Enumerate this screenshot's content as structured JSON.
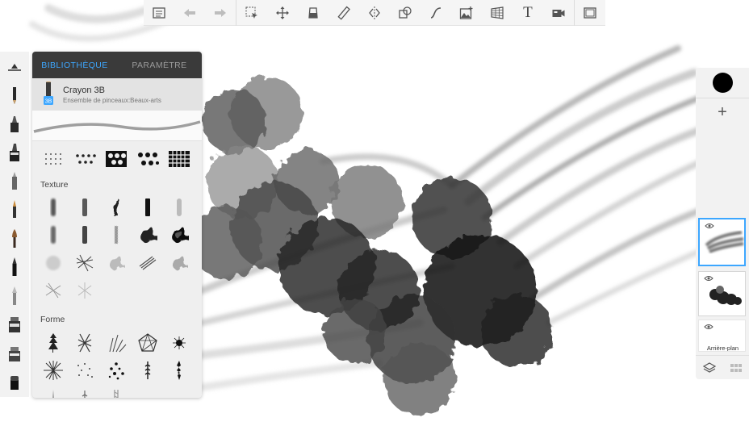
{
  "top_toolbar": {
    "tools": [
      "list-icon",
      "undo-icon",
      "redo-icon",
      "select-icon",
      "move-icon",
      "fill-icon",
      "ruler-icon",
      "symmetry-icon",
      "shapes-icon",
      "curve-icon",
      "image-icon",
      "perspective-icon",
      "text-icon",
      "video-icon",
      "fullscreen-icon"
    ],
    "text_tool_glyph": "T"
  },
  "brush_panel": {
    "tabs": [
      {
        "label": "BIBLIOTHÈQUE",
        "active": true
      },
      {
        "label": "PARAMÈTRE",
        "active": false
      }
    ],
    "current_brush": {
      "name": "Crayon 3B",
      "set": "Ensemble de pinceaux:Beaux-arts",
      "badge": "3B"
    },
    "sections": [
      {
        "label": ""
      },
      {
        "label": "Texture"
      },
      {
        "label": "Forme"
      }
    ]
  },
  "right_panel": {
    "active_color": "#000000",
    "add_symbol": "+",
    "layers": [
      {
        "name": "layer-1",
        "visible": true,
        "selected": true
      },
      {
        "name": "layer-2",
        "visible": true,
        "selected": false
      },
      {
        "name": "background",
        "label": "Arrière-plan",
        "visible": true,
        "selected": false
      }
    ]
  },
  "colors": {
    "accent": "#3da7ff",
    "tab_bar": "#3a3a3a",
    "panel": "#efefef"
  }
}
